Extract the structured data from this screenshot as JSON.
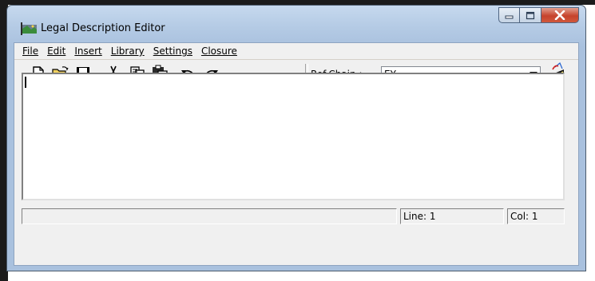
{
  "window": {
    "title": "Legal Description Editor"
  },
  "menu": {
    "items": [
      {
        "label": "File"
      },
      {
        "label": "Edit"
      },
      {
        "label": "Insert"
      },
      {
        "label": "Library"
      },
      {
        "label": "Settings"
      },
      {
        "label": "Closure"
      }
    ]
  },
  "toolbar": {
    "buttons": [
      {
        "name": "new-file-icon"
      },
      {
        "name": "open-folder-icon"
      },
      {
        "name": "save-icon"
      },
      {
        "name": "cut-icon"
      },
      {
        "name": "copy-icon"
      },
      {
        "name": "paste-icon"
      },
      {
        "name": "undo-icon"
      },
      {
        "name": "redo-icon"
      }
    ],
    "refchain_label": "Ref.Chain :",
    "refchain_value": "EY",
    "chain_tool_icon": "chain-tool-icon"
  },
  "editor": {
    "content": ""
  },
  "status": {
    "message": "",
    "line": "Line: 1",
    "col": "Col: 1"
  },
  "colors": {
    "frame": "#a9c1de",
    "close_button": "#c6432c",
    "client": "#f0f0f0"
  }
}
